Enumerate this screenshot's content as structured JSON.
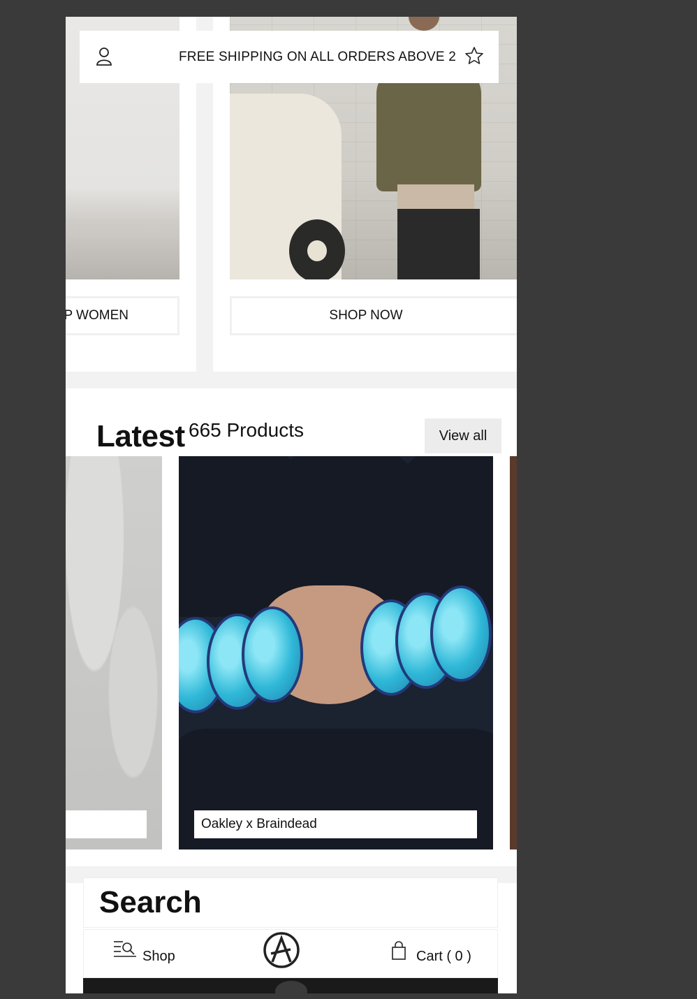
{
  "header": {
    "announcement": "FREE SHIPPING ON ALL ORDERS ABOVE 2",
    "user_icon": "user-icon",
    "wishlist_icon": "star-icon"
  },
  "hero": {
    "left_button_label": "P WOMEN",
    "right_button_label": "SHOP NOW"
  },
  "latest": {
    "title": "Latest",
    "count": "665 Products",
    "view_all_label": "View all",
    "products": [
      {
        "name": ""
      },
      {
        "name": "Oakley x Braindead"
      }
    ]
  },
  "search": {
    "title": "Search"
  },
  "bottom_nav": {
    "shop_label": "Shop",
    "shop_icon": "menu-search-icon",
    "logo_icon": "brand-logo-icon",
    "cart_label": "Cart ( 0 )",
    "cart_icon": "shopping-bag-icon"
  },
  "colors": {
    "page_background": "#3a3a3a",
    "section_gap": "#f2f2f2",
    "button_grey": "#ececec"
  }
}
